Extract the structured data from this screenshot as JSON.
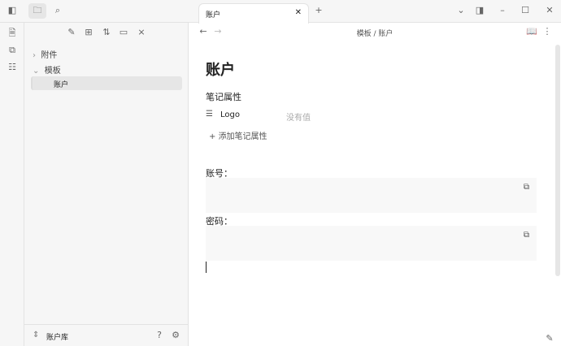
{
  "sidebar": {
    "folders": [
      {
        "label": "附件",
        "expanded": false
      },
      {
        "label": "模板",
        "expanded": true
      }
    ],
    "active_file": "账户",
    "vault_name": "账户库"
  },
  "tab": {
    "title": "账户"
  },
  "header": {
    "breadcrumb_folder": "模板",
    "breadcrumb_sep": "/",
    "breadcrumb_file": "账户"
  },
  "note": {
    "title": "账户",
    "properties_heading": "笔记属性",
    "property_name": "Logo",
    "property_value": "没有值",
    "add_property": "添加笔记属性",
    "field1": "账号：",
    "field2": "密码："
  }
}
